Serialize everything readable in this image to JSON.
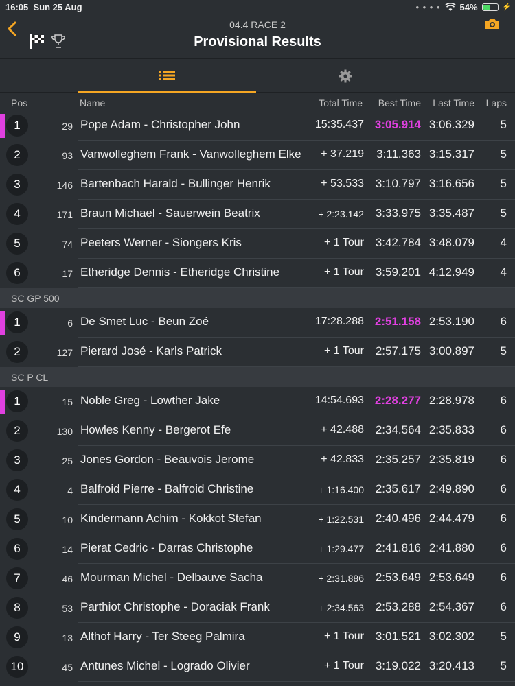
{
  "status": {
    "time": "16:05",
    "date": "Sun 25 Aug",
    "battery": "54%",
    "battery_level": 0.54,
    "dots": "• • • •"
  },
  "header": {
    "subtitle": "04.4 RACE 2",
    "title": "Provisional Results"
  },
  "icons": {
    "back": "chevron-left-icon",
    "flag": "checkered-flag-icon",
    "trophy": "trophy-icon",
    "camera": "camera-icon",
    "list": "list-icon",
    "settings": "gear-icon"
  },
  "colors": {
    "accent": "#f5a623",
    "fastest": "#e040e0",
    "background": "#2b2f33"
  },
  "columns": {
    "pos": "Pos",
    "name": "Name",
    "total": "Total Time",
    "best": "Best Time",
    "last": "Last Time",
    "laps": "Laps"
  },
  "groups": [
    {
      "title": "",
      "rows": [
        {
          "pos": "1",
          "num": "29",
          "name": "Pope Adam - Christopher John",
          "total": "15:35.437",
          "best": "3:05.914",
          "last": "3:06.329",
          "laps": "5",
          "fastest": true
        },
        {
          "pos": "2",
          "num": "93",
          "name": "Vanwolleghem Frank - Vanwolleghem Elke",
          "total": "+ 37.219",
          "best": "3:11.363",
          "last": "3:15.317",
          "laps": "5"
        },
        {
          "pos": "3",
          "num": "146",
          "name": "Bartenbach Harald - Bullinger Henrik",
          "total": "+ 53.533",
          "best": "3:10.797",
          "last": "3:16.656",
          "laps": "5"
        },
        {
          "pos": "4",
          "num": "171",
          "name": "Braun Michael - Sauerwein Beatrix",
          "total": "+ 2:23.142",
          "best": "3:33.975",
          "last": "3:35.487",
          "laps": "5"
        },
        {
          "pos": "5",
          "num": "74",
          "name": "Peeters Werner - Siongers Kris",
          "total": "+ 1 Tour",
          "best": "3:42.784",
          "last": "3:48.079",
          "laps": "4"
        },
        {
          "pos": "6",
          "num": "17",
          "name": "Etheridge Dennis - Etheridge Christine",
          "total": "+ 1 Tour",
          "best": "3:59.201",
          "last": "4:12.949",
          "laps": "4"
        }
      ]
    },
    {
      "title": "SC GP 500",
      "rows": [
        {
          "pos": "1",
          "num": "6",
          "name": "De Smet Luc - Beun Zoé",
          "total": "17:28.288",
          "best": "2:51.158",
          "last": "2:53.190",
          "laps": "6",
          "fastest": true
        },
        {
          "pos": "2",
          "num": "127",
          "name": "Pierard José - Karls Patrick",
          "total": "+ 1 Tour",
          "best": "2:57.175",
          "last": "3:00.897",
          "laps": "5"
        }
      ]
    },
    {
      "title": "SC P CL",
      "rows": [
        {
          "pos": "1",
          "num": "15",
          "name": "Noble Greg - Lowther Jake",
          "total": "14:54.693",
          "best": "2:28.277",
          "last": "2:28.978",
          "laps": "6",
          "fastest": true
        },
        {
          "pos": "2",
          "num": "130",
          "name": "Howles Kenny - Bergerot Efe",
          "total": "+ 42.488",
          "best": "2:34.564",
          "last": "2:35.833",
          "laps": "6"
        },
        {
          "pos": "3",
          "num": "25",
          "name": "Jones Gordon - Beauvois Jerome",
          "total": "+ 42.833",
          "best": "2:35.257",
          "last": "2:35.819",
          "laps": "6"
        },
        {
          "pos": "4",
          "num": "4",
          "name": "Balfroid Pierre - Balfroid Christine",
          "total": "+ 1:16.400",
          "best": "2:35.617",
          "last": "2:49.890",
          "laps": "6"
        },
        {
          "pos": "5",
          "num": "10",
          "name": "Kindermann Achim - Kokkot Stefan",
          "total": "+ 1:22.531",
          "best": "2:40.496",
          "last": "2:44.479",
          "laps": "6"
        },
        {
          "pos": "6",
          "num": "14",
          "name": "Pierat Cedric - Darras Christophe",
          "total": "+ 1:29.477",
          "best": "2:41.816",
          "last": "2:41.880",
          "laps": "6"
        },
        {
          "pos": "7",
          "num": "46",
          "name": "Mourman Michel - Delbauve Sacha",
          "total": "+ 2:31.886",
          "best": "2:53.649",
          "last": "2:53.649",
          "laps": "6"
        },
        {
          "pos": "8",
          "num": "53",
          "name": "Parthiot Christophe - Doraciak Frank",
          "total": "+ 2:34.563",
          "best": "2:53.288",
          "last": "2:54.367",
          "laps": "6"
        },
        {
          "pos": "9",
          "num": "13",
          "name": "Althof Harry - Ter Steeg Palmira",
          "total": "+ 1 Tour",
          "best": "3:01.521",
          "last": "3:02.302",
          "laps": "5"
        },
        {
          "pos": "10",
          "num": "45",
          "name": "Antunes Michel - Logrado Olivier",
          "total": "+ 1 Tour",
          "best": "3:19.022",
          "last": "3:20.413",
          "laps": "5"
        }
      ]
    }
  ]
}
